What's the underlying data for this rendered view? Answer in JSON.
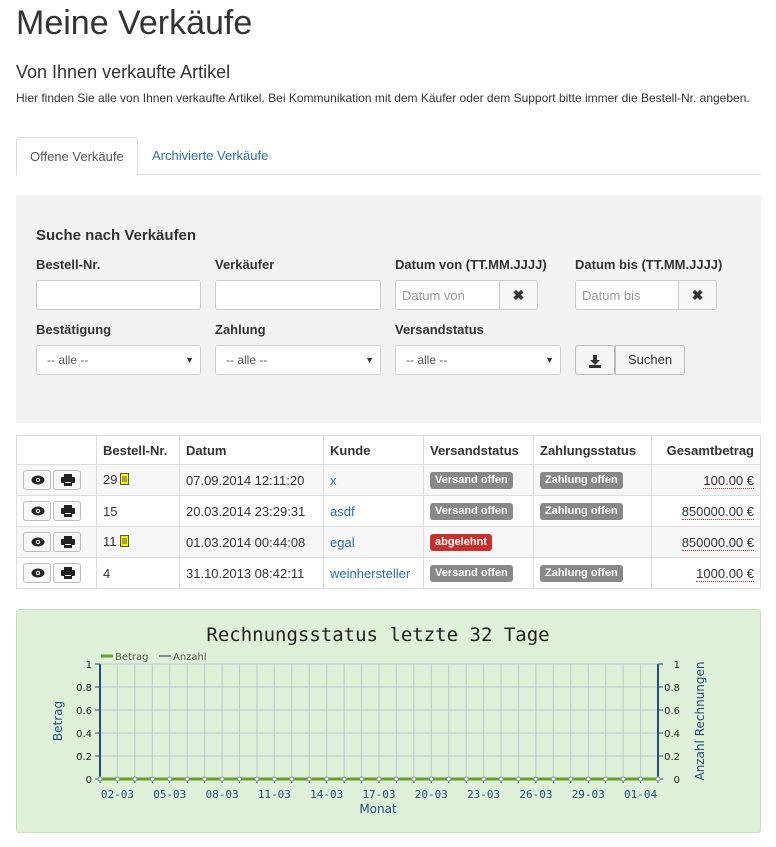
{
  "header": {
    "title": "Meine Verkäufe",
    "subtitle": "Von Ihnen verkaufte Artikel",
    "intro": "Hier finden Sie alle von Ihnen verkaufte Artikel. Bei Kommunikation mit dem Käufer oder dem Support bitte immer die Bestell-Nr. angeben."
  },
  "tabs": [
    {
      "label": "Offene Verkäufe",
      "active": true
    },
    {
      "label": "Archivierte Verkäufe",
      "active": false
    }
  ],
  "search": {
    "title": "Suche nach Verkäufen",
    "order_no_label": "Bestell-Nr.",
    "order_no_value": "",
    "seller_label": "Verkäufer",
    "seller_value": "",
    "date_from_label": "Datum von (TT.MM.JJJJ)",
    "date_from_placeholder": "Datum von",
    "date_to_label": "Datum bis (TT.MM.JJJJ)",
    "date_to_placeholder": "Datum bis",
    "confirmation_label": "Bestätigung",
    "confirmation_value": "-- alle --",
    "payment_label": "Zahlung",
    "payment_value": "-- alle --",
    "shipping_label": "Versandstatus",
    "shipping_value": "-- alle --",
    "search_button": "Suchen",
    "clear_icon": "times-icon",
    "download_icon": "download-icon"
  },
  "table": {
    "headers": [
      "",
      "Bestell-Nr.",
      "Datum",
      "Kunde",
      "Versandstatus",
      "Zahlungsstatus",
      "Gesamtbetrag"
    ],
    "rows": [
      {
        "order_no": "29",
        "has_note": true,
        "date": "07.09.2014 12:11:20",
        "customer": "x",
        "shipping": "Versand offen",
        "shipping_color": "#888888",
        "payment": "Zahlung offen",
        "amount": "100.00 €"
      },
      {
        "order_no": "15",
        "has_note": false,
        "date": "20.03.2014 23:29:31",
        "customer": "asdf",
        "shipping": "Versand offen",
        "shipping_color": "#888888",
        "payment": "Zahlung offen",
        "amount": "850000.00 €"
      },
      {
        "order_no": "11",
        "has_note": true,
        "date": "01.03.2014 00:44:08",
        "customer": "egal",
        "shipping": "abgelehnt",
        "shipping_color": "#c9302c",
        "payment": "",
        "amount": "850000.00 €"
      },
      {
        "order_no": "4",
        "has_note": false,
        "date": "31.10.2013 08:42:11",
        "customer": "weinhersteller",
        "shipping": "Versand offen",
        "shipping_color": "#888888",
        "payment": "Zahlung offen",
        "amount": "1000.00 €"
      }
    ],
    "row_icons": [
      "eye-icon",
      "print-icon"
    ]
  },
  "colors": {
    "link": "#2a6ebb",
    "badge_grey": "#888888",
    "badge_red": "#c9302c",
    "chart_bg": "#dff0d8",
    "series_betrag": "#6a9e2a",
    "series_anzahl": "#7f8c95",
    "axis": "#1f4e79"
  },
  "chart_data": {
    "type": "line",
    "title": "Rechnungsstatus letzte 32 Tage",
    "xlabel": "Monat",
    "ylabel_left": "Betrag",
    "ylabel_right": "Anzahl Rechnungen",
    "legend": [
      "Betrag",
      "Anzahl"
    ],
    "legend_position": "top-left",
    "x_tick_labels": [
      "02-03",
      "05-03",
      "08-03",
      "11-03",
      "14-03",
      "17-03",
      "20-03",
      "23-03",
      "26-03",
      "29-03",
      "01-04"
    ],
    "x": [
      "01-03",
      "02-03",
      "03-03",
      "04-03",
      "05-03",
      "06-03",
      "07-03",
      "08-03",
      "09-03",
      "10-03",
      "11-03",
      "12-03",
      "13-03",
      "14-03",
      "15-03",
      "16-03",
      "17-03",
      "18-03",
      "19-03",
      "20-03",
      "21-03",
      "22-03",
      "23-03",
      "24-03",
      "25-03",
      "26-03",
      "27-03",
      "28-03",
      "29-03",
      "30-03",
      "31-03",
      "01-04",
      "02-04"
    ],
    "series": [
      {
        "name": "Betrag",
        "values": [
          0,
          0,
          0,
          0,
          0,
          0,
          0,
          0,
          0,
          0,
          0,
          0,
          0,
          0,
          0,
          0,
          0,
          0,
          0,
          0,
          0,
          0,
          0,
          0,
          0,
          0,
          0,
          0,
          0,
          0,
          0,
          0,
          0
        ]
      },
      {
        "name": "Anzahl",
        "values": [
          0,
          0,
          0,
          0,
          0,
          0,
          0,
          0,
          0,
          0,
          0,
          0,
          0,
          0,
          0,
          0,
          0,
          0,
          0,
          0,
          0,
          0,
          0,
          0,
          0,
          0,
          0,
          0,
          0,
          0,
          0,
          0,
          0
        ]
      }
    ],
    "y_ticks": [
      "0",
      "0.2",
      "0.4",
      "0.6",
      "0.8",
      "1"
    ],
    "ylim": [
      0,
      1
    ],
    "y2lim": [
      0,
      1
    ],
    "grid": true
  }
}
